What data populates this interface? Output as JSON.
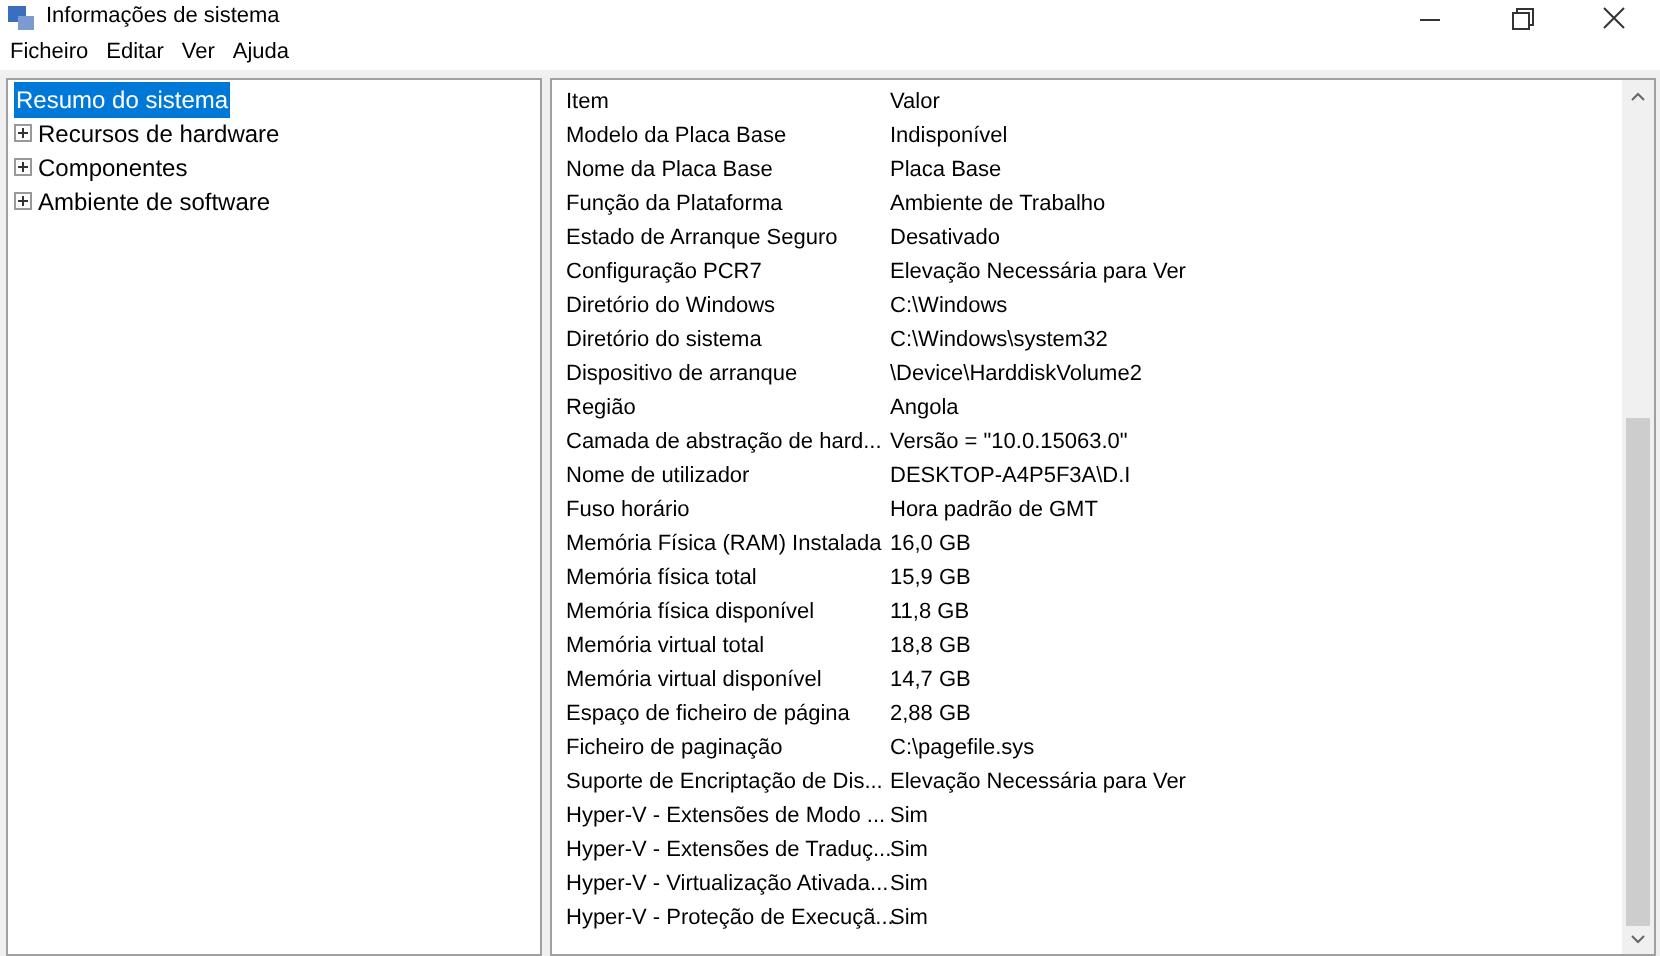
{
  "window": {
    "title": "Informações de sistema"
  },
  "menu": [
    "Ficheiro",
    "Editar",
    "Ver",
    "Ajuda"
  ],
  "tree": [
    {
      "label": "Resumo do sistema",
      "selected": true
    },
    {
      "label": "Recursos de hardware",
      "selected": false,
      "expanded": false
    },
    {
      "label": "Componentes",
      "selected": false,
      "expanded": false
    },
    {
      "label": "Ambiente de software",
      "selected": false,
      "expanded": false
    }
  ],
  "table": {
    "columns": [
      "Item",
      "Valor"
    ],
    "rows": [
      [
        "Modelo da Placa Base",
        "Indisponível"
      ],
      [
        "Nome da Placa Base",
        "Placa Base"
      ],
      [
        "Função da Plataforma",
        "Ambiente de Trabalho"
      ],
      [
        "Estado de Arranque Seguro",
        "Desativado"
      ],
      [
        "Configuração PCR7",
        "Elevação Necessária para Ver"
      ],
      [
        "Diretório do Windows",
        "C:\\Windows"
      ],
      [
        "Diretório do sistema",
        "C:\\Windows\\system32"
      ],
      [
        "Dispositivo de arranque",
        "\\Device\\HarddiskVolume2"
      ],
      [
        "Região",
        "Angola"
      ],
      [
        "Camada de abstração de hard...",
        "Versão = \"10.0.15063.0\""
      ],
      [
        "Nome de utilizador",
        "DESKTOP-A4P5F3A\\D.I"
      ],
      [
        "Fuso horário",
        "Hora padrão de GMT"
      ],
      [
        "Memória Física (RAM) Instalada",
        "16,0 GB"
      ],
      [
        "Memória física total",
        "15,9 GB"
      ],
      [
        "Memória física disponível",
        "11,8 GB"
      ],
      [
        "Memória virtual total",
        "18,8 GB"
      ],
      [
        "Memória virtual disponível",
        "14,7 GB"
      ],
      [
        "Espaço de ficheiro de página",
        "2,88 GB"
      ],
      [
        "Ficheiro de paginação",
        "C:\\pagefile.sys"
      ],
      [
        "Suporte de Encriptação de Dis...",
        "Elevação Necessária para Ver"
      ],
      [
        "Hyper-V - Extensões de Modo ...",
        "Sim"
      ],
      [
        "Hyper-V - Extensões de Traduç...",
        "Sim"
      ],
      [
        "Hyper-V - Virtualização Ativada...",
        "Sim"
      ],
      [
        "Hyper-V - Proteção de Execuçã...",
        "Sim"
      ]
    ]
  }
}
